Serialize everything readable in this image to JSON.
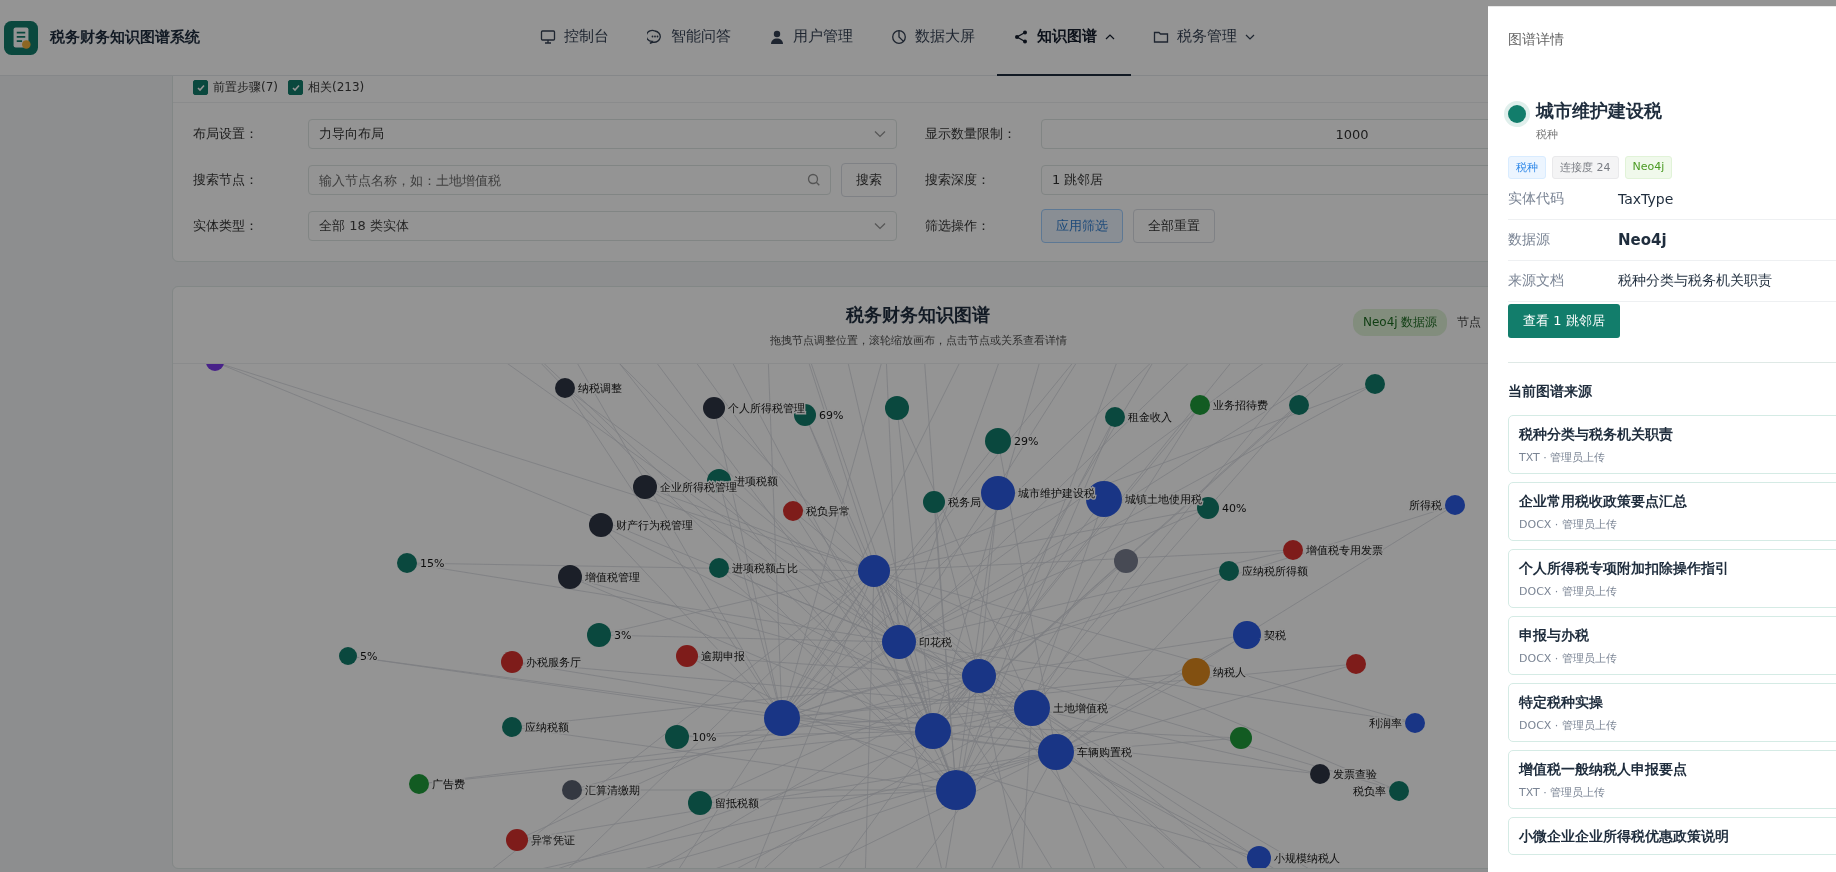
{
  "app": {
    "title": "税务财务知识图谱系统"
  },
  "nav": [
    {
      "label": "控制台",
      "selected": false,
      "dropdown": false
    },
    {
      "label": "智能问答",
      "selected": false,
      "dropdown": false
    },
    {
      "label": "用户管理",
      "selected": false,
      "dropdown": false
    },
    {
      "label": "数据大屏",
      "selected": false,
      "dropdown": false
    },
    {
      "label": "知识图谱",
      "selected": true,
      "dropdown": true,
      "expanded": true
    },
    {
      "label": "税务管理",
      "selected": false,
      "dropdown": true,
      "expanded": false
    }
  ],
  "filters": {
    "checks": [
      {
        "label": "前置步骤(7)",
        "checked": true
      },
      {
        "label": "相关(213)",
        "checked": true
      }
    ],
    "layout": {
      "label": "布局设置：",
      "value": "力导向布局"
    },
    "limit": {
      "label": "显示数量限制：",
      "value": "1000"
    },
    "search": {
      "label": "搜索节点：",
      "placeholder": "输入节点名称，如：土地增值税",
      "button": "搜索"
    },
    "depth": {
      "label": "搜索深度：",
      "value": "1 跳邻居"
    },
    "entity_type": {
      "label": "实体类型：",
      "value": "全部 18 类实体"
    },
    "actions": {
      "label": "筛选操作：",
      "buttons": [
        {
          "label": "应用筛选",
          "kind": "primary"
        },
        {
          "label": "全部重置",
          "kind": "default"
        }
      ]
    }
  },
  "graph": {
    "title": "税务财务知识图谱",
    "subtitle": "拖拽节点调整位置，滚轮缩放画布，点击节点或关系查看详情",
    "source_tag": "Neo4j 数据源",
    "stats_label": "节点",
    "nodes": [
      {
        "color": "#482289"
      },
      {
        "label": "纳税调整",
        "color": "#1b1f28"
      },
      {
        "label": "个人所得税管理",
        "color": "#1b1f28"
      },
      {
        "label": "69%",
        "color": "#0a483e"
      },
      {
        "color": "#0a483e"
      },
      {
        "label": "租金收入",
        "color": "#0a483e"
      },
      {
        "label": "业务招待费",
        "color": "#125b22"
      },
      {
        "color": "#0a483e"
      },
      {
        "color": "#0a483e"
      },
      {
        "label": "29%",
        "color": "#0a483e"
      },
      {
        "label": "进项税额",
        "color": "#0a483e"
      },
      {
        "label": "企业所得税管理",
        "color": "#1b1f28"
      },
      {
        "label": "税负异常",
        "color": "#7e1c1a"
      },
      {
        "label": "税务局",
        "color": "#0a483e"
      },
      {
        "label": "城市维护建设税",
        "color": "#193585"
      },
      {
        "label": "城镇土地使用税",
        "color": "#193585"
      },
      {
        "label": "40%",
        "color": "#0a483e"
      },
      {
        "label": "所得税",
        "color": "#193585"
      },
      {
        "label": "财产行为税管理",
        "color": "#1b1f28"
      },
      {
        "label": "15%",
        "color": "#0a483e"
      },
      {
        "label": "增值税管理",
        "color": "#1b1f28"
      },
      {
        "label": "进项税额占比",
        "color": "#0a483e"
      },
      {
        "color": "#193585"
      },
      {
        "color": "#474a54"
      },
      {
        "label": "增值税专用发票",
        "color": "#7e1c1a"
      },
      {
        "label": "应纳税所得额",
        "color": "#0a483e"
      },
      {
        "label": "5%",
        "color": "#0a483e"
      },
      {
        "label": "3%",
        "color": "#0a483e"
      },
      {
        "label": "印花税",
        "color": "#193585"
      },
      {
        "label": "契税",
        "color": "#193585"
      },
      {
        "label": "逾期申报",
        "color": "#7e1c1a"
      },
      {
        "label": "办税服务厅",
        "color": "#7e1c1a"
      },
      {
        "color": "#193585"
      },
      {
        "label": "纳税人",
        "color": "#825011"
      },
      {
        "color": "#7e1c1a"
      },
      {
        "color": "#193585"
      },
      {
        "label": "土地增值税",
        "color": "#193585"
      },
      {
        "color": "#193585"
      },
      {
        "label": "应纳税额",
        "color": "#0a483e"
      },
      {
        "label": "10%",
        "color": "#0a483e"
      },
      {
        "label": "利润率",
        "color": "#193585"
      },
      {
        "color": "#125b22"
      },
      {
        "label": "车辆购置税",
        "color": "#193585"
      },
      {
        "color": "#193585"
      },
      {
        "label": "广告费",
        "color": "#125b22"
      },
      {
        "label": "汇算清缴期",
        "color": "#343841"
      },
      {
        "label": "留抵税额",
        "color": "#0a483e"
      },
      {
        "label": "发票查验",
        "color": "#1b1f28"
      },
      {
        "label": "税负率",
        "color": "#0a483e"
      },
      {
        "label": "异常凭证",
        "color": "#7e1c1a"
      },
      {
        "label": "小规模纳税人",
        "color": "#193585"
      }
    ]
  },
  "drawer": {
    "title": "图谱详情",
    "entity": {
      "name": "城市维护建设税",
      "type": "税种",
      "color": "#127d6b"
    },
    "tags": [
      {
        "label": "税种",
        "kind": "type"
      },
      {
        "label": "连接度 24",
        "kind": "degree"
      },
      {
        "label": "Neo4j",
        "kind": "source"
      }
    ],
    "fields": [
      {
        "label": "实体代码",
        "value": "TaxType",
        "bold": false
      },
      {
        "label": "数据源",
        "value": "Neo4j",
        "bold": true
      },
      {
        "label": "来源文档",
        "value": "税种分类与税务机关职责",
        "bold": false
      }
    ],
    "button": "查看 1 跳邻居",
    "sources_title": "当前图谱来源",
    "sources": [
      {
        "title": "税种分类与税务机关职责",
        "meta": "TXT · 管理员上传"
      },
      {
        "title": "企业常用税收政策要点汇总",
        "meta": "DOCX · 管理员上传"
      },
      {
        "title": "个人所得税专项附加扣除操作指引",
        "meta": "DOCX · 管理员上传"
      },
      {
        "title": "申报与办税",
        "meta": "DOCX · 管理员上传"
      },
      {
        "title": "特定税种实操",
        "meta": "DOCX · 管理员上传"
      },
      {
        "title": "增值税一般纳税人申报要点",
        "meta": "TXT · 管理员上传"
      },
      {
        "title": "小微企业企业所得税优惠政策说明"
      }
    ]
  }
}
